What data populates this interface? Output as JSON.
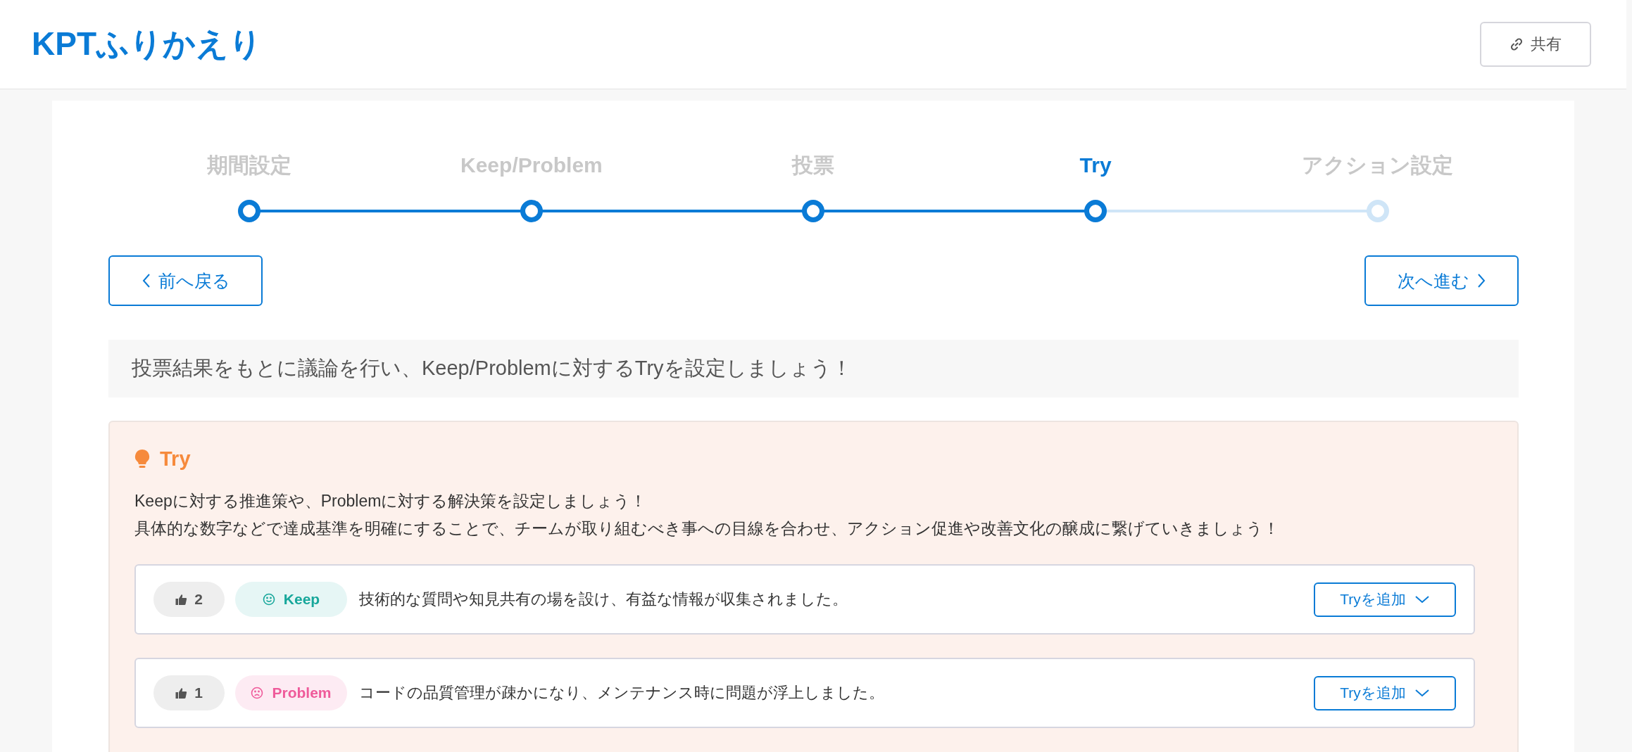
{
  "header": {
    "title": "KPTふりかえり",
    "share_button": "共有"
  },
  "stepper": {
    "steps": [
      {
        "label": "期間設定",
        "selected": false,
        "completed": true
      },
      {
        "label": "Keep/Problem",
        "selected": false,
        "completed": true
      },
      {
        "label": "投票",
        "selected": false,
        "completed": true
      },
      {
        "label": "Try",
        "selected": true,
        "completed": true
      },
      {
        "label": "アクション設定",
        "selected": false,
        "completed": false
      }
    ]
  },
  "nav": {
    "back_button": "前へ戻る",
    "next_button": "次へ進む"
  },
  "instruction": "投票結果をもとに議論を行い、Keep/Problemに対するTryを設定しましょう！",
  "try_panel": {
    "title": "Try",
    "description": [
      "Keepに対する推進策や、Problemに対する解決策を設定しましょう！",
      "具体的な数字などで達成基準を明確にすることで、チームが取り組むべき事への目線を合わせ、アクション促進や改善文化の醸成に繋げていきましょう！"
    ],
    "items": [
      {
        "votes": "2",
        "kind": "keep",
        "badge": "Keep",
        "text": "技術的な質問や知見共有の場を設け、有益な情報が収集されました。",
        "button": "Tryを追加"
      },
      {
        "votes": "1",
        "kind": "problem",
        "badge": "Problem",
        "text": "コードの品質管理が疎かになり、メンテナンス時に問題が浮上しました。",
        "button": "Tryを追加"
      }
    ]
  }
}
